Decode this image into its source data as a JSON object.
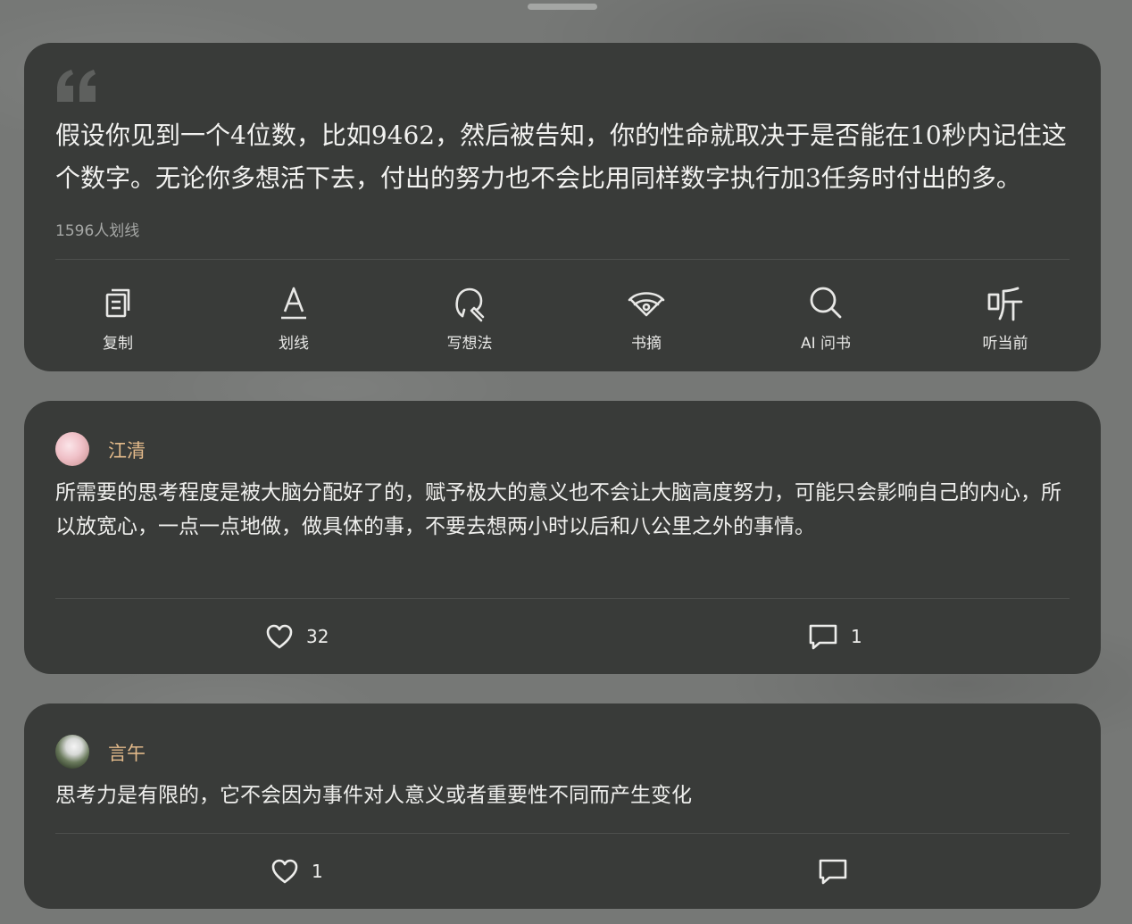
{
  "quote_card": {
    "text": "假设你见到一个4位数，比如9462，然后被告知，你的性命就取决于是否能在10秒内记住这个数字。无论你多想活下去，付出的努力也不会比用同样数字执行加3任务时付出的多。",
    "highlight_count": "1596人划线",
    "actions": [
      {
        "label": "复制",
        "icon": "copy-icon"
      },
      {
        "label": "划线",
        "icon": "underline-icon"
      },
      {
        "label": "写想法",
        "icon": "thought-icon"
      },
      {
        "label": "书摘",
        "icon": "excerpt-icon"
      },
      {
        "label": "AI 问书",
        "icon": "search-icon"
      },
      {
        "label": "听当前",
        "icon": "listen-icon"
      }
    ]
  },
  "comments": [
    {
      "username": "江清",
      "text": "所需要的思考程度是被大脑分配好了的，赋予极大的意义也不会让大脑高度努力，可能只会影响自己的内心，所以放宽心，一点一点地做，做具体的事，不要去想两小时以后和八公里之外的事情。",
      "likes": "32",
      "replies": "1"
    },
    {
      "username": "言午",
      "text": "思考力是有限的，它不会因为事件对人意义或者重要性不同而产生变化",
      "likes": "1",
      "replies": ""
    }
  ],
  "colors": {
    "card_background": "#393b39",
    "page_background": "#767876",
    "username": "#e2b98a",
    "text": "#f2f2f0",
    "muted": "#a6a8a6"
  }
}
